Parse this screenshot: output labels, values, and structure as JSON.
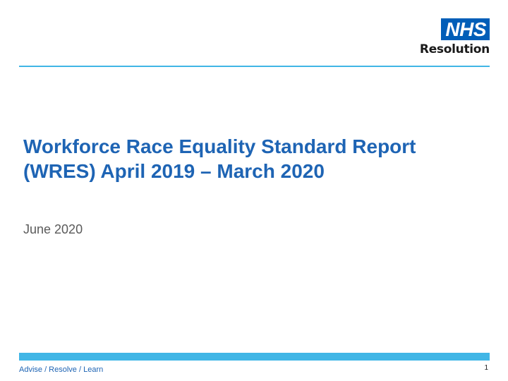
{
  "slide": {
    "logo": {
      "mark_text": "NHS",
      "sub_text": "Resolution",
      "brand_color": "#005EB8"
    },
    "title": "Workforce Race Equality Standard Report (WRES) April 2019 – March 2020",
    "subtitle": "June 2020",
    "footer": {
      "tagline": "Advise / Resolve / Learn",
      "page_number": "1"
    },
    "colors": {
      "title": "#1E64B4",
      "accent_bar": "#41B6E6",
      "subtitle": "#5a5a5a"
    }
  }
}
